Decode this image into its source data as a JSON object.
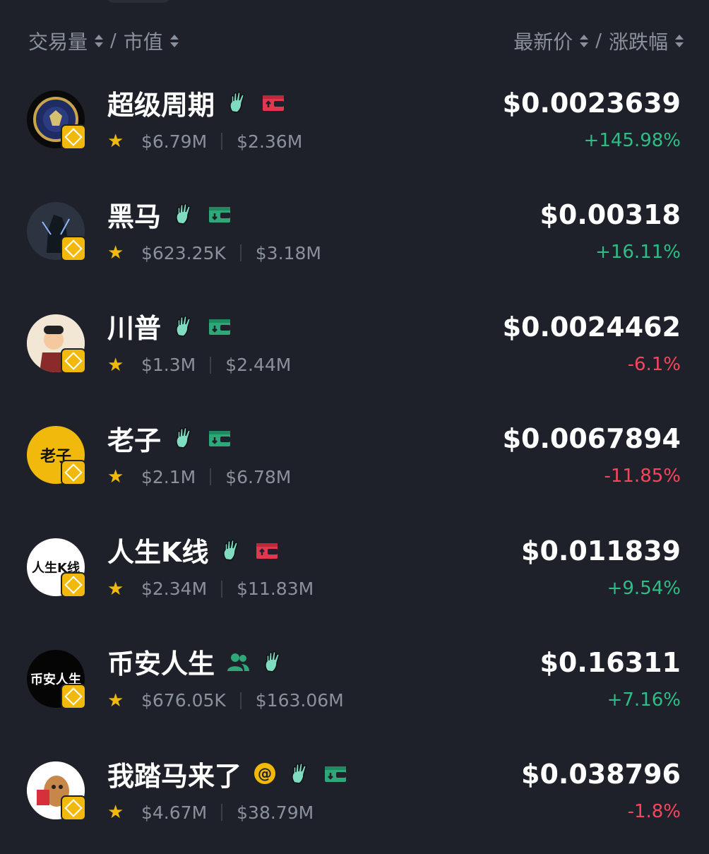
{
  "header": {
    "left_col_a": "交易量",
    "left_col_b": "市值",
    "right_col_a": "最新价",
    "right_col_b": "涨跌幅",
    "separator": "/"
  },
  "colors": {
    "background": "#1e2129",
    "positive": "#2ebd85",
    "negative": "#f6465d",
    "star": "#f0b90b",
    "muted": "#8b919c"
  },
  "rows": [
    {
      "name": "超级周期",
      "avatar_text": "",
      "avatar_color": "#0d0d0d",
      "avatar_icon": "sec-seal-avatar",
      "tags": [
        "hand-icon",
        "red-wallet-icon"
      ],
      "volume": "$6.79M",
      "market_cap": "$2.36M",
      "price": "$0.0023639",
      "change": "+145.98%",
      "direction": "up"
    },
    {
      "name": "黑马",
      "avatar_text": "",
      "avatar_color": "#2b3440",
      "avatar_icon": "dark-horse-avatar",
      "tags": [
        "hand-icon",
        "green-wallet-icon"
      ],
      "volume": "$623.25K",
      "market_cap": "$3.18M",
      "price": "$0.00318",
      "change": "+16.11%",
      "direction": "up"
    },
    {
      "name": "川普",
      "avatar_text": "",
      "avatar_color": "#f2e6d4",
      "avatar_icon": "cartoon-avatar",
      "tags": [
        "hand-icon",
        "green-wallet-icon"
      ],
      "volume": "$1.3M",
      "market_cap": "$2.44M",
      "price": "$0.0024462",
      "change": "-6.1%",
      "direction": "down"
    },
    {
      "name": "老子",
      "avatar_text": "老子",
      "avatar_color": "#f0b90b",
      "avatar_icon": "text-avatar",
      "tags": [
        "hand-icon",
        "green-wallet-icon"
      ],
      "volume": "$2.1M",
      "market_cap": "$6.78M",
      "price": "$0.0067894",
      "change": "-11.85%",
      "direction": "down"
    },
    {
      "name": "人生K线",
      "avatar_text": "人生K线",
      "avatar_color": "#ffffff",
      "avatar_icon": "text-avatar",
      "tags": [
        "hand-icon",
        "red-wallet-icon"
      ],
      "volume": "$2.34M",
      "market_cap": "$11.83M",
      "price": "$0.011839",
      "change": "+9.54%",
      "direction": "up"
    },
    {
      "name": "币安人生",
      "avatar_text": "币安人生",
      "avatar_color": "#050505",
      "avatar_icon": "text-avatar",
      "tags": [
        "users-icon",
        "hand-icon"
      ],
      "volume": "$676.05K",
      "market_cap": "$163.06M",
      "price": "$0.16311",
      "change": "+7.16%",
      "direction": "up"
    },
    {
      "name": "我踏马来了",
      "avatar_text": "",
      "avatar_color": "#ffffff",
      "avatar_icon": "horse-cartoon-avatar",
      "tags": [
        "at-icon",
        "hand-icon",
        "green-wallet-icon"
      ],
      "volume": "$4.67M",
      "market_cap": "$38.79M",
      "price": "$0.038796",
      "change": "-1.8%",
      "direction": "down"
    }
  ]
}
